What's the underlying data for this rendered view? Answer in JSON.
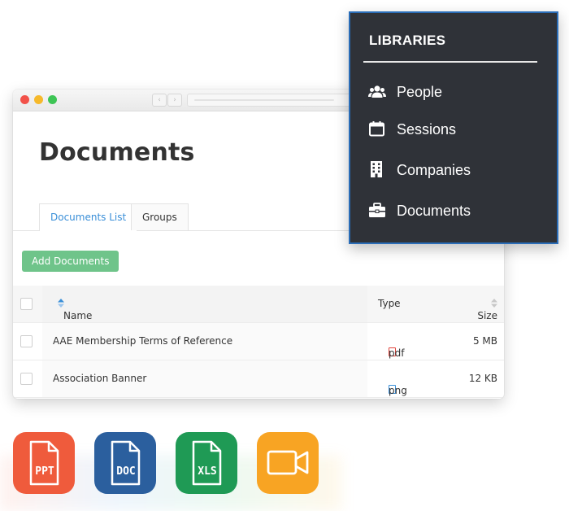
{
  "window": {
    "back_glyph": "‹",
    "forward_glyph": "›"
  },
  "page": {
    "title": "Documents",
    "tabs": [
      {
        "label": "Documents List",
        "active": true
      },
      {
        "label": "Groups",
        "active": false
      }
    ],
    "add_button_label": "Add Documents"
  },
  "table": {
    "columns": {
      "name": "Name",
      "type": "Type",
      "size": "Size"
    },
    "rows": [
      {
        "name": "AAE Membership Terms of Reference",
        "type": "pdf",
        "type_icon": "pdf-file-icon",
        "size": "5 MB"
      },
      {
        "name": "Association Banner",
        "type": "png",
        "type_icon": "image-file-icon",
        "size": "12 KB"
      }
    ]
  },
  "libraries": {
    "title": "LIBRARIES",
    "items": [
      {
        "label": "People",
        "icon": "people-icon"
      },
      {
        "label": "Sessions",
        "icon": "calendar-icon"
      },
      {
        "label": "Companies",
        "icon": "building-icon"
      },
      {
        "label": "Documents",
        "icon": "briefcase-icon"
      }
    ]
  },
  "file_types": [
    {
      "label": "PPT",
      "color": "#ef5b3c"
    },
    {
      "label": "DOC",
      "color": "#2b5f9e"
    },
    {
      "label": "XLS",
      "color": "#1f9a55"
    },
    {
      "label": "video",
      "color": "#f8a423"
    }
  ],
  "colors": {
    "accent": "#3a8fd8",
    "add_button": "#6fc48a",
    "panel_bg": "#2f3238",
    "panel_border": "#2a6db8",
    "pdf": "#e0433b",
    "png": "#3a8fd8"
  }
}
